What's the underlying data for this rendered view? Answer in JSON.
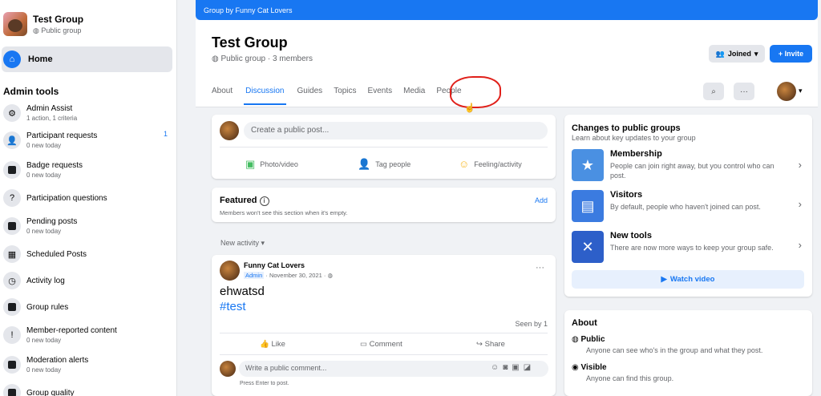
{
  "sidebar": {
    "group_name": "Test Group",
    "group_privacy": "Public group",
    "home_label": "Home",
    "admin_tools_heading": "Admin tools",
    "items": [
      {
        "label": "Admin Assist",
        "sub": "1 action, 1 criteria",
        "icon": "gear-icon"
      },
      {
        "label": "Participant requests",
        "sub": "0 new today",
        "icon": "person-add-icon",
        "badge": "1"
      },
      {
        "label": "Badge requests",
        "sub": "0 new today",
        "icon": "badge-icon"
      },
      {
        "label": "Participation questions",
        "sub": "",
        "icon": "questions-icon"
      },
      {
        "label": "Pending posts",
        "sub": "0 new today",
        "icon": "pending-posts-icon"
      },
      {
        "label": "Scheduled Posts",
        "sub": "",
        "icon": "calendar-icon"
      },
      {
        "label": "Activity log",
        "sub": "",
        "icon": "clock-icon"
      },
      {
        "label": "Group rules",
        "sub": "",
        "icon": "rules-icon"
      },
      {
        "label": "Member-reported content",
        "sub": "0 new today",
        "icon": "report-icon"
      },
      {
        "label": "Moderation alerts",
        "sub": "0 new today",
        "icon": "alert-icon"
      },
      {
        "label": "Group quality",
        "sub": "",
        "icon": "quality-icon"
      }
    ]
  },
  "banner": "Group by Funny Cat Lovers",
  "header": {
    "title": "Test Group",
    "subtitle": "Public group · 3 members",
    "joined_label": "Joined",
    "invite_label": "+ Invite",
    "tabs": [
      "About",
      "Discussion",
      "Guides",
      "Topics",
      "Events",
      "Media",
      "People"
    ],
    "active_tab": "Discussion"
  },
  "composer": {
    "placeholder": "Create a public post...",
    "actions": [
      "Photo/video",
      "Tag people",
      "Feeling/activity"
    ]
  },
  "featured": {
    "title": "Featured",
    "desc": "Members won't see this section when it's empty.",
    "add_label": "Add"
  },
  "feed": {
    "new_activity_label": "New activity",
    "post": {
      "author": "Funny Cat Lovers",
      "role": "Admin",
      "date": "November 30, 2021",
      "text": "ehwatsd",
      "hashtag": "#test",
      "seen_by": "Seen by 1",
      "like_label": "Like",
      "comment_label": "Comment",
      "share_label": "Share",
      "comment_placeholder": "Write a public comment...",
      "enter_hint": "Press Enter to post."
    }
  },
  "changes": {
    "title": "Changes to public groups",
    "subtitle": "Learn about key updates to your group",
    "items": [
      {
        "title": "Membership",
        "desc": "People can join right away, but you control who can post."
      },
      {
        "title": "Visitors",
        "desc": "By default, people who haven't joined can post."
      },
      {
        "title": "New tools",
        "desc": "There are now more ways to keep your group safe."
      }
    ],
    "watch_label": "Watch video"
  },
  "about": {
    "title": "About",
    "items": [
      {
        "title": "Public",
        "desc": "Anyone can see who's in the group and what they post."
      },
      {
        "title": "Visible",
        "desc": "Anyone can find this group."
      }
    ]
  },
  "colors": {
    "accent": "#1877f2",
    "annotation": "#e0201a"
  }
}
